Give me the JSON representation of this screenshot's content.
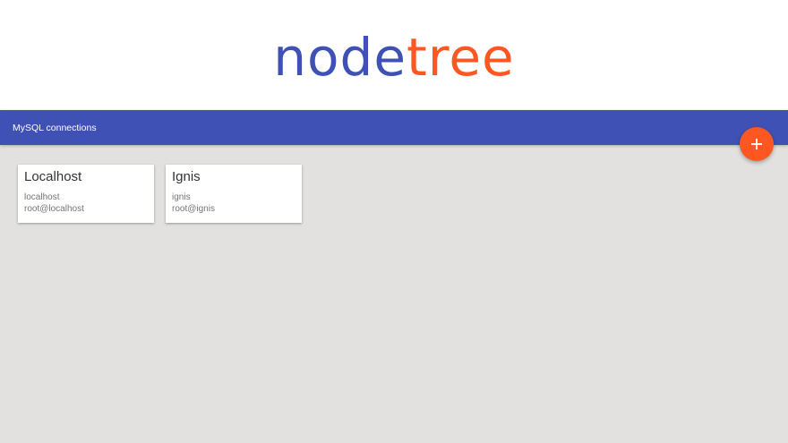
{
  "logo": {
    "part1": "node",
    "part2": "tree"
  },
  "toolbar": {
    "title": "MySQL connections"
  },
  "fab": {
    "icon": "plus-icon"
  },
  "connections": [
    {
      "name": "Localhost",
      "host": "localhost",
      "user": "root@localhost"
    },
    {
      "name": "Ignis",
      "host": "ignis",
      "user": "root@ignis"
    }
  ],
  "colors": {
    "primary": "#3f51b5",
    "accent": "#ff5722",
    "background": "#e2e1e0"
  }
}
